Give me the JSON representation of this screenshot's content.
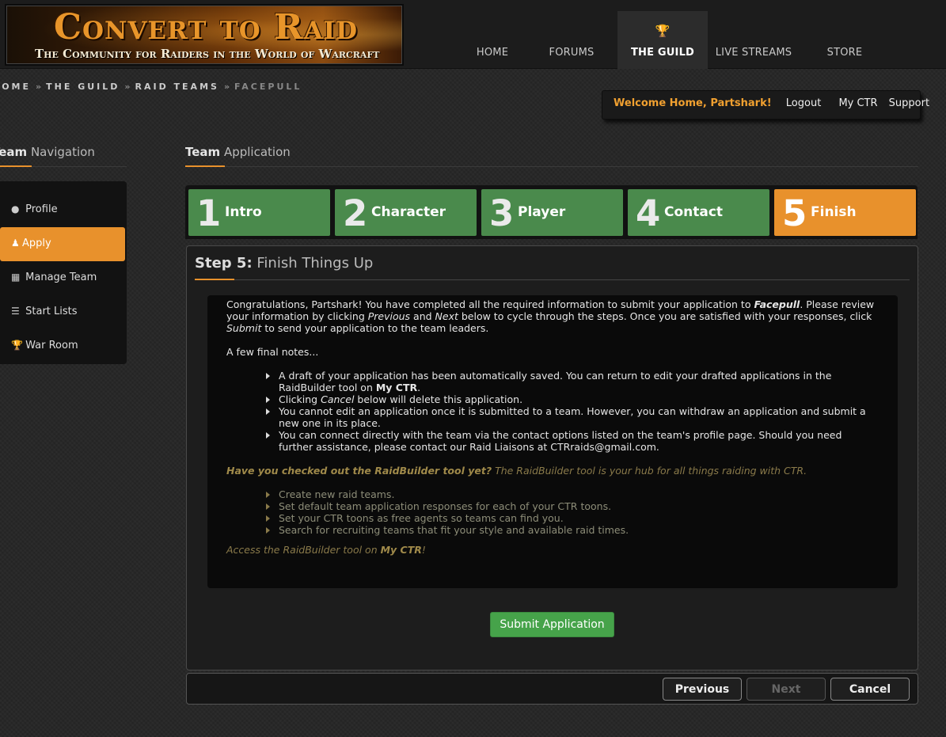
{
  "header": {
    "logo_title": "Convert to Raid",
    "logo_subtitle": "The Community for Raiders in the World of Warcraft",
    "nav": [
      {
        "label": "HOME"
      },
      {
        "label": "FORUMS"
      },
      {
        "label": "THE GUILD",
        "icon": "trophy-icon",
        "active": true
      },
      {
        "label": "LIVE STREAMS"
      },
      {
        "label": "STORE"
      }
    ]
  },
  "breadcrumb": [
    "HOME",
    "THE GUILD",
    "RAID TEAMS",
    "FACEPULL"
  ],
  "user_box": {
    "welcome": "Welcome Home, Partshark!",
    "logout": "Logout",
    "my_ctr": "My CTR",
    "support": "Support"
  },
  "side_nav": {
    "title_bold": "Team",
    "title_rest": "Navigation",
    "items": [
      {
        "label": "Profile",
        "icon": "users-icon"
      },
      {
        "label": "Apply",
        "icon": "user-icon",
        "active": true
      },
      {
        "label": "Manage Team",
        "icon": "puzzle-icon"
      },
      {
        "label": "Start Lists",
        "icon": "list-icon"
      },
      {
        "label": "War Room",
        "icon": "trophy-icon"
      }
    ]
  },
  "main": {
    "title_bold": "Team",
    "title_rest": "Application",
    "steps": [
      {
        "num": "1",
        "label": "Intro"
      },
      {
        "num": "2",
        "label": "Character"
      },
      {
        "num": "3",
        "label": "Player"
      },
      {
        "num": "4",
        "label": "Contact"
      },
      {
        "num": "5",
        "label": "Finish",
        "active": true
      }
    ],
    "panel_title_bold": "Step 5:",
    "panel_title_rest": "Finish Things Up",
    "intro": {
      "a": "Congratulations, Partshark! You have completed all the required information to submit your application to ",
      "team": "Facepull",
      "b": ". Please review your information by clicking ",
      "prev": "Previous",
      "c": " and ",
      "next": "Next",
      "d": " below to cycle through the steps. Once you are satisfied with your responses, click ",
      "submit": "Submit",
      "e": " to send your application to the team leaders."
    },
    "notes_heading": "A few final notes...",
    "notes": {
      "n1a": "A draft of your application has been automatically saved. You can return to edit your drafted applications in the RaidBuilder tool on ",
      "n1b": "My CTR",
      "n1c": ".",
      "n2a": "Clicking ",
      "n2b": "Cancel",
      "n2c": " below will delete this application.",
      "n3": "You cannot edit an application once it is submitted to a team. However, you can withdraw an application and submit a new one in its place.",
      "n4": "You can connect directly with the team via the contact options listed on the team's profile page. Should you need further assistance, please contact our Raid Liaisons at CTRraids@gmail.com."
    },
    "raidbuilder": {
      "question": "Have you checked out the RaidBuilder tool yet?",
      "question_rest": " The RaidBuilder tool is your hub for all things raiding with CTR.",
      "items": [
        "Create new raid teams.",
        "Set default team application responses for each of your CTR toons.",
        "Set your CTR toons as free agents so teams can find you.",
        "Search for recruiting teams that fit your style and available raid times."
      ],
      "access_a": "Access the RaidBuilder tool on ",
      "access_b": "My CTR",
      "access_c": "!"
    },
    "submit_label": "Submit Application",
    "footer": {
      "previous": "Previous",
      "next": "Next",
      "cancel": "Cancel"
    }
  }
}
